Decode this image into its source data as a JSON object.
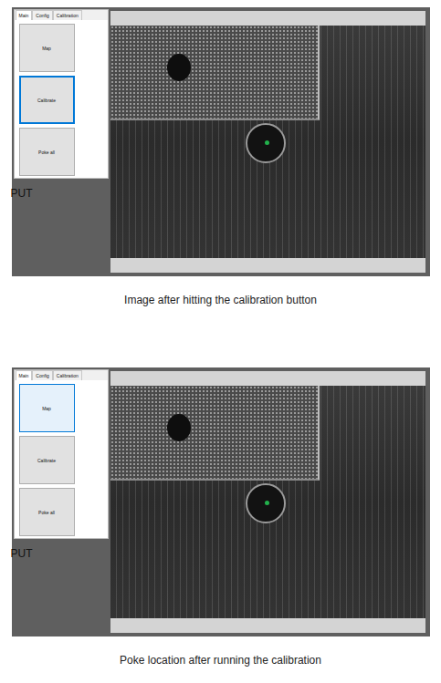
{
  "figures": [
    {
      "app": {
        "tabs": [
          {
            "label": "Main",
            "selected": true
          },
          {
            "label": "Config",
            "selected": false
          },
          {
            "label": "Calibration",
            "selected": false
          }
        ],
        "buttons": [
          {
            "label": "Map",
            "focused": false,
            "hovered": false
          },
          {
            "label": "Calibrate",
            "focused": true,
            "hovered": false
          },
          {
            "label": "Poke all",
            "focused": false,
            "hovered": false
          }
        ],
        "output_label": "PUT"
      },
      "caption": "Image after hitting the calibration button"
    },
    {
      "app": {
        "tabs": [
          {
            "label": "Main",
            "selected": true
          },
          {
            "label": "Config",
            "selected": false
          },
          {
            "label": "Calibration",
            "selected": false
          }
        ],
        "buttons": [
          {
            "label": "Map",
            "focused": false,
            "hovered": true
          },
          {
            "label": "Calibrate",
            "focused": false,
            "hovered": false
          },
          {
            "label": "Poke all",
            "focused": false,
            "hovered": false
          }
        ],
        "output_label": "PUT"
      },
      "caption": "Poke location after running the calibration"
    }
  ]
}
